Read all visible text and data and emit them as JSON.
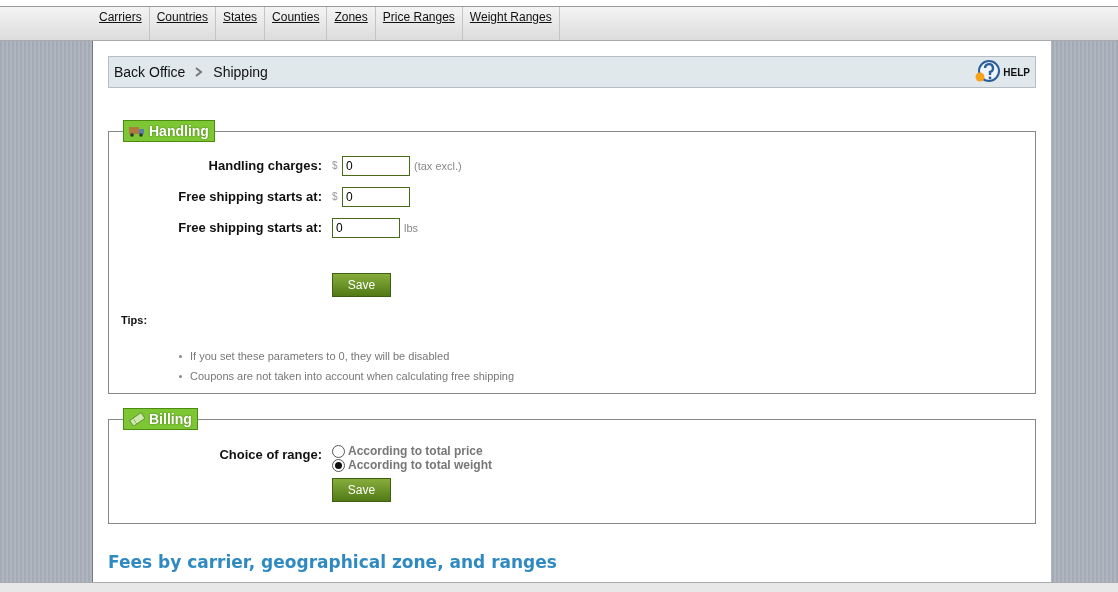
{
  "tabs": [
    {
      "label": "Carriers"
    },
    {
      "label": "Countries"
    },
    {
      "label": "States"
    },
    {
      "label": "Counties"
    },
    {
      "label": "Zones"
    },
    {
      "label": "Price Ranges"
    },
    {
      "label": "Weight Ranges"
    }
  ],
  "breadcrumb": {
    "items": [
      "Back Office",
      "Shipping"
    ],
    "help": "HELP"
  },
  "handling": {
    "title": "Handling",
    "fields": [
      {
        "label": "Handling charges:",
        "prefix": "$",
        "value": "0",
        "suffix": "(tax excl.)"
      },
      {
        "label": "Free shipping starts at:",
        "prefix": "$",
        "value": "0"
      },
      {
        "label": "Free shipping starts at:",
        "value": "0",
        "suffix": "lbs"
      }
    ],
    "button": "Save",
    "tips_label": "Tips:",
    "tips": [
      "If you set these parameters to 0, they will be disabled",
      "Coupons are not taken into account when calculating free shipping"
    ]
  },
  "billing": {
    "title": "Billing",
    "label": "Choice of range:",
    "options": [
      {
        "label": "According to total price",
        "selected": false
      },
      {
        "label": "According to total weight",
        "selected": true
      }
    ],
    "button": "Save"
  },
  "section_heading": "Fees by carrier, geographical zone, and ranges"
}
